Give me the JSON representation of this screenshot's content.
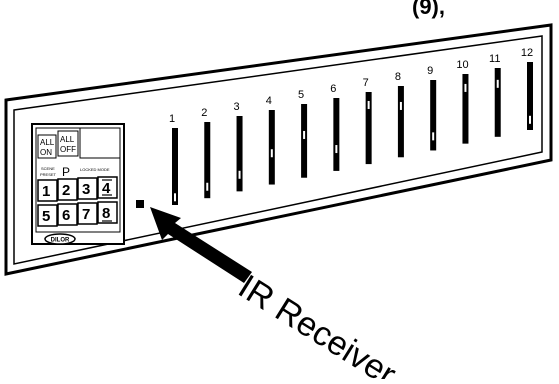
{
  "top_fragment": "(9),",
  "keypad": {
    "all_on": [
      "ALL",
      "ON"
    ],
    "all_off": [
      "ALL",
      "OFF"
    ],
    "scene_label": [
      "SCENE",
      "PRESET"
    ],
    "scene_value": "P",
    "mode_label": "LOCKED MODE",
    "keys": [
      "1",
      "2",
      "3",
      "4",
      "5",
      "6",
      "7",
      "8"
    ],
    "brand": "DILOR"
  },
  "channels": [
    "1",
    "2",
    "3",
    "4",
    "5",
    "6",
    "7",
    "8",
    "9",
    "10",
    "11",
    "12"
  ],
  "slider_levels": [
    0.1,
    0.15,
    0.22,
    0.42,
    0.58,
    0.3,
    0.82,
    0.72,
    0.2,
    0.8,
    0.77,
    0.15
  ],
  "callout": {
    "label": "IR Receiver"
  }
}
